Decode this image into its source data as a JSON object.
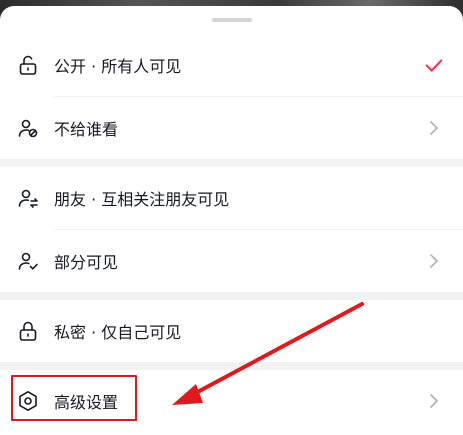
{
  "sheet": {
    "options": [
      {
        "label": "公开 · 所有人可见",
        "icon": "unlock-icon",
        "selected": true
      },
      {
        "label": "不给谁看",
        "icon": "user-blocked-icon",
        "selected": false
      },
      {
        "label": "朋友 · 互相关注朋友可见",
        "icon": "user-mutual-icon",
        "selected": false
      },
      {
        "label": "部分可见",
        "icon": "user-check-icon",
        "selected": false
      },
      {
        "label": "私密 · 仅自己可见",
        "icon": "lock-icon",
        "selected": false
      },
      {
        "label": "高级设置",
        "icon": "settings-hexagon-icon",
        "selected": false
      }
    ]
  },
  "colors": {
    "accent_check": "#fe2c55",
    "annotation": "#e0191c",
    "text": "#161823",
    "chevron": "#b0b0b4"
  }
}
